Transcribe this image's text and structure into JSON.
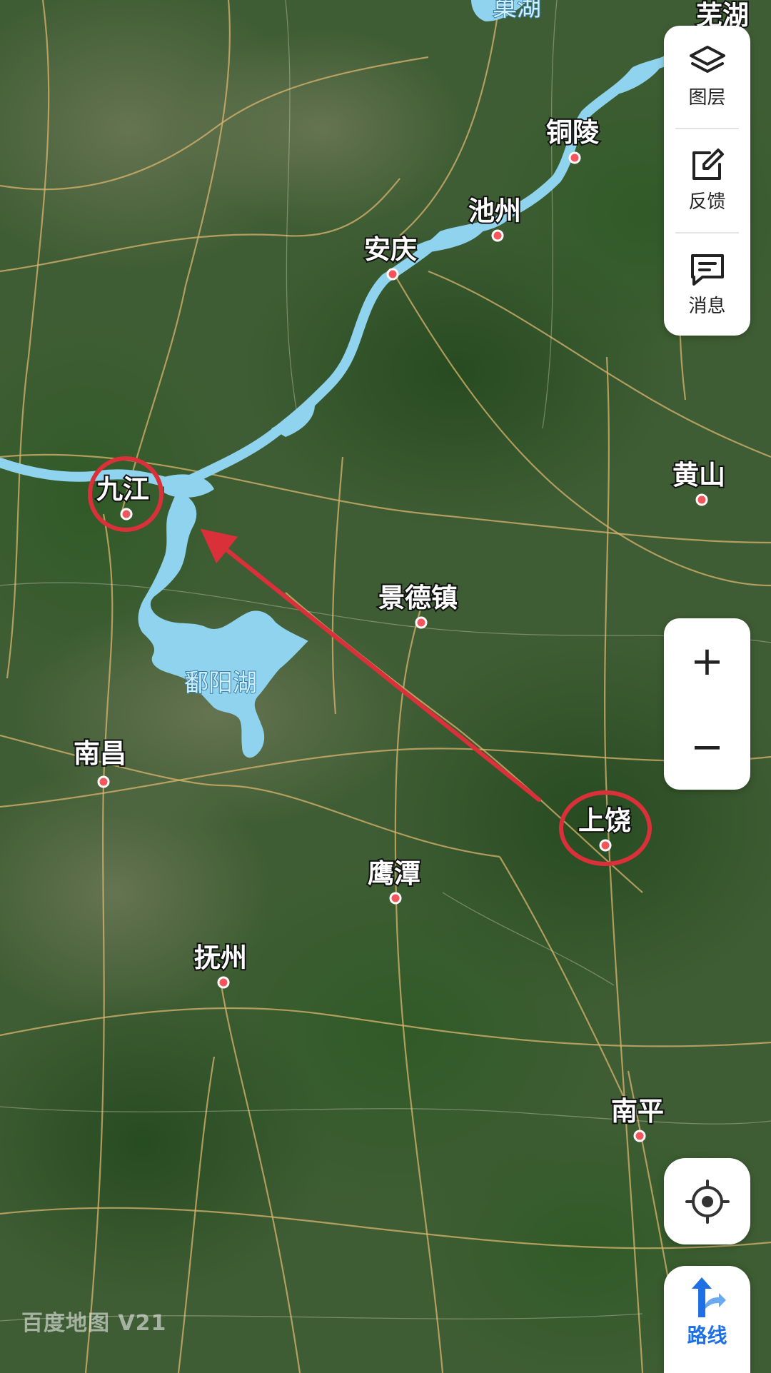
{
  "map": {
    "cities": [
      {
        "id": "wuhu",
        "name": "芜湖"
      },
      {
        "id": "tongling",
        "name": "铜陵"
      },
      {
        "id": "chizhou",
        "name": "池州"
      },
      {
        "id": "anqing",
        "name": "安庆"
      },
      {
        "id": "jiujiang",
        "name": "九江"
      },
      {
        "id": "huangshan",
        "name": "黄山"
      },
      {
        "id": "jingdezhen",
        "name": "景德镇"
      },
      {
        "id": "nanchang",
        "name": "南昌"
      },
      {
        "id": "shangrao",
        "name": "上饶"
      },
      {
        "id": "yingtan",
        "name": "鹰潭"
      },
      {
        "id": "fuzhou",
        "name": "抚州"
      },
      {
        "id": "nanping",
        "name": "南平"
      }
    ],
    "lakes": {
      "chaohu": "巢湖",
      "poyang": "鄱阳湖"
    },
    "annotation": {
      "arrow_from": "上饶",
      "arrow_to": "九江",
      "circled": [
        "九江",
        "上饶"
      ],
      "color": "#d9303a"
    },
    "colors": {
      "water": "#8fd3ee",
      "road": "#d9b46e",
      "terrain": "#3e5f33"
    }
  },
  "controls": {
    "layers_label": "图层",
    "feedback_label": "反馈",
    "messages_label": "消息",
    "zoom_in_label": "+",
    "zoom_out_label": "−",
    "route_label": "路线"
  },
  "watermark": "百度地图 V21"
}
